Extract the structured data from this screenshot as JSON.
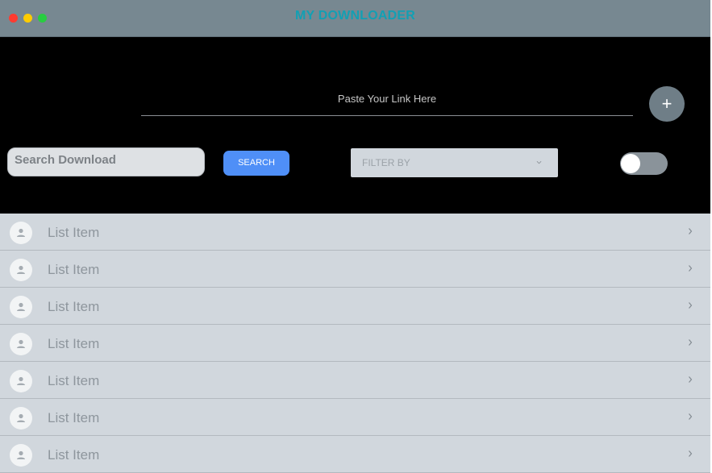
{
  "window": {
    "title": "MY DOWNLOADER"
  },
  "link_input": {
    "placeholder": "Paste Your Link Here",
    "add_button_label": "+"
  },
  "search": {
    "placeholder": "Search Download",
    "button_label": "SEARCH"
  },
  "filter": {
    "label": "FILTER BY",
    "icon": "chevron-down-icon"
  },
  "toggle": {
    "state": "off"
  },
  "list": {
    "items": [
      {
        "label": "List Item",
        "icon": "person-icon"
      },
      {
        "label": "List Item",
        "icon": "person-icon"
      },
      {
        "label": "List Item",
        "icon": "person-icon"
      },
      {
        "label": "List Item",
        "icon": "person-icon"
      },
      {
        "label": "List Item",
        "icon": "person-icon"
      },
      {
        "label": "List Item",
        "icon": "person-icon"
      },
      {
        "label": "List Item",
        "icon": "person-icon"
      }
    ]
  },
  "colors": {
    "titlebar": "#778891",
    "title_text": "#12a0b4",
    "panel_bg": "#000000",
    "search_button": "#4f8ff7",
    "list_bg": "#d1d7dd"
  }
}
